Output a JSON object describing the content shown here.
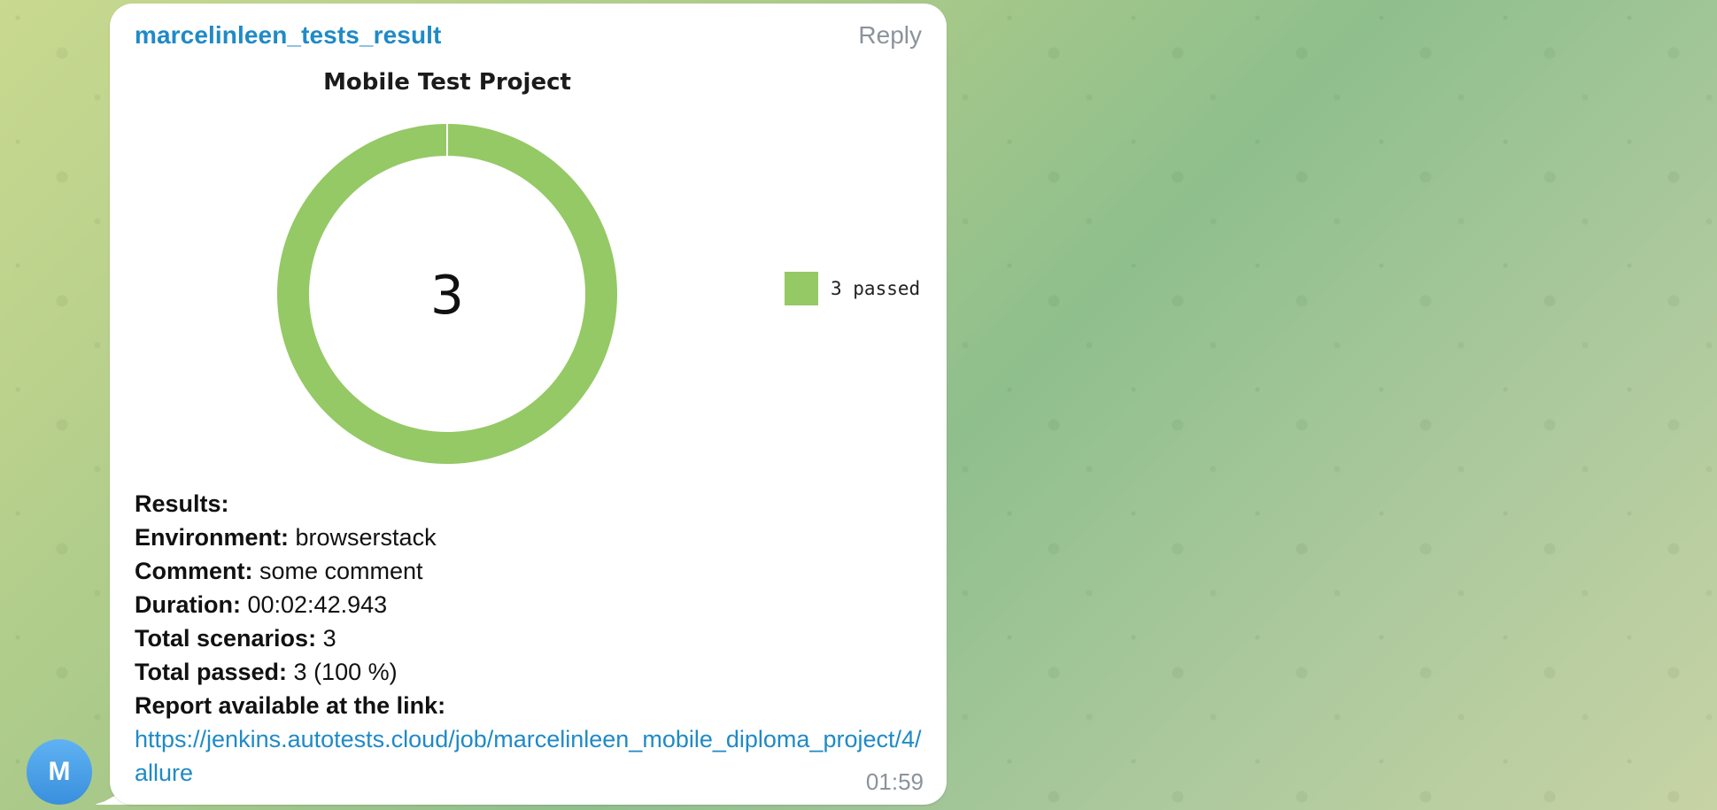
{
  "message": {
    "sender": "marcelinleen_tests_result",
    "reply_label": "Reply",
    "time": "01:59",
    "avatar_letter": "M"
  },
  "chart_data": {
    "type": "pie",
    "title": "Mobile Test Project",
    "center_label": "3",
    "series": [
      {
        "name": "3 passed",
        "value": 3,
        "color": "#94c965"
      }
    ],
    "legend_position": "right"
  },
  "results": {
    "heading": "Results:",
    "rows": [
      {
        "label": "Environment:",
        "value": " browserstack"
      },
      {
        "label": "Comment:",
        "value": " some comment"
      },
      {
        "label": "Duration:",
        "value": " 00:02:42.943"
      },
      {
        "label": "Total scenarios:",
        "value": " 3"
      },
      {
        "label": "Total passed:",
        "value": " 3 (100 %)"
      }
    ],
    "link_label": "Report available at the link:",
    "link": "https://jenkins.autotests.cloud/job/marcelinleen_mobile_diploma_project/4/allure"
  }
}
